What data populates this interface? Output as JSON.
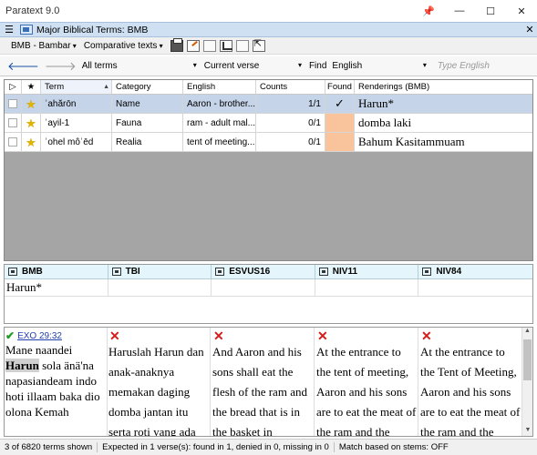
{
  "window": {
    "title": "Paratext 9.0",
    "pin_glyph": "📌",
    "min_glyph": "—",
    "max_glyph": "☐",
    "close_glyph": "✕"
  },
  "panel": {
    "menu_glyph": "☰",
    "title": "Major Biblical Terms: BMB",
    "close_glyph": "✕"
  },
  "toolbar": {
    "project": "BMB - Bambar",
    "comparative": "Comparative texts"
  },
  "filterbar": {
    "back_glyph": "🡐",
    "forward_glyph": "🡒",
    "terms_filter": "All terms",
    "verse_filter": "Current verse",
    "find_label": "Find",
    "find_language": "English",
    "find_placeholder": "Type English",
    "caret": "▾"
  },
  "terms_table": {
    "headers": {
      "flag": "▷",
      "star": "★",
      "term": "Term",
      "category": "Category",
      "english": "English",
      "counts": "Counts",
      "found": "Found",
      "renderings": "Renderings (BMB)"
    },
    "sort_glyph": "▲",
    "star_glyph": "★",
    "rows": [
      {
        "term": "ʾahărōn",
        "category": "Name",
        "english": "Aaron - brother...",
        "counts": "1/1",
        "found": "✓",
        "renderings": "Harun*"
      },
      {
        "term": "ʾayil-1",
        "category": "Fauna",
        "english": "ram - adult mal...",
        "counts": "0/1",
        "found": "",
        "renderings": "domba laki"
      },
      {
        "term": "ʾohel môʿēd",
        "category": "Realia",
        "english": "tent of meeting...",
        "counts": "0/1",
        "found": "",
        "renderings": "Bahum Kasitammuam"
      }
    ]
  },
  "renderings_grid": {
    "columns": [
      "BMB",
      "TBI",
      "ESVUS16",
      "NIV11",
      "NIV84"
    ],
    "values": [
      "Harun*",
      "",
      "",
      "",
      ""
    ]
  },
  "texts": {
    "reference": "EXO 29:32",
    "ok_glyph": "✔",
    "bad_glyph": "✕",
    "bmb_before": "Mane naandei ",
    "bmb_highlight": "Harun",
    "bmb_after": " sola änä'na napasiandeam indo hoti illaam baka dio olona Kemah",
    "tbi": "Haruslah Harun dan anak-anaknya memakan daging domba jantan itu serta roti yang ada",
    "esv": "And Aaron and his sons shall eat the flesh of the ram and the bread that is in the basket in",
    "niv11": "At the entrance to the tent of meeting, Aaron and his sons are to eat the meat of the ram and the",
    "niv84": "At the entrance to the Tent of Meeting, Aaron and his sons are to eat the meat of the ram and the"
  },
  "status": {
    "count": "3 of 6820 terms shown",
    "expected": "Expected in 1 verse(s): found in 1, denied in 0, missing in 0",
    "match": "Match based on stems: OFF"
  }
}
